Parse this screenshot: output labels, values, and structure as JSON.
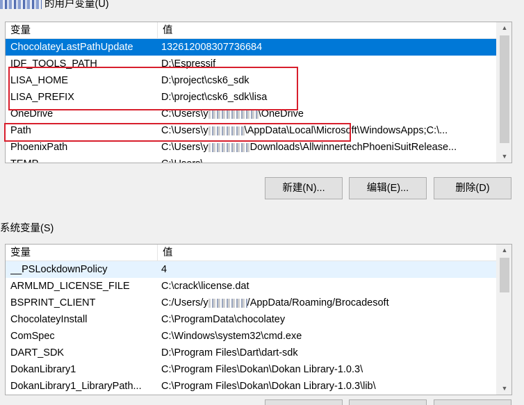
{
  "user_vars": {
    "title": "的用户变量(U)",
    "columns": {
      "name": "变量",
      "value": "值"
    },
    "rows": [
      {
        "name": "ChocolateyLastPathUpdate",
        "value": "132612008307736684",
        "selected": true
      },
      {
        "name": "IDF_TOOLS_PATH",
        "value": "D:\\Espressif"
      },
      {
        "name": "LISA_HOME",
        "value": "D:\\project\\csk6_sdk"
      },
      {
        "name": "LISA_PREFIX",
        "value": "D:\\project\\csk6_sdk\\lisa"
      },
      {
        "name": "OneDrive",
        "value_pre": "C:\\Users\\y",
        "value_post": "\\OneDrive"
      },
      {
        "name": "Path",
        "value_pre": "C:\\Users\\y",
        "value_post": "\\AppData\\Local\\Microsoft\\WindowsApps;C:\\..."
      },
      {
        "name": "PhoenixPath",
        "value_pre": "C:\\Users\\y",
        "value_post": "Downloads\\AllwinnertechPhoeniSuitRelease..."
      },
      {
        "name": "TEMP",
        "value": "C:\\Users\\..."
      }
    ],
    "buttons": {
      "new": "新建(N)...",
      "edit": "编辑(E)...",
      "delete": "删除(D)"
    }
  },
  "system_vars": {
    "title": "系统变量(S)",
    "columns": {
      "name": "变量",
      "value": "值"
    },
    "rows": [
      {
        "name": "__PSLockdownPolicy",
        "value": "4",
        "hover": true
      },
      {
        "name": "ARMLMD_LICENSE_FILE",
        "value": "C:\\crack\\license.dat"
      },
      {
        "name": "BSPRINT_CLIENT",
        "value_pre": "C:/Users/y",
        "value_post": "/AppData/Roaming/Brocadesoft"
      },
      {
        "name": "ChocolateyInstall",
        "value": "C:\\ProgramData\\chocolatey"
      },
      {
        "name": "ComSpec",
        "value": "C:\\Windows\\system32\\cmd.exe"
      },
      {
        "name": "DART_SDK",
        "value": "D:\\Program Files\\Dart\\dart-sdk"
      },
      {
        "name": "DokanLibrary1",
        "value": "C:\\Program Files\\Dokan\\Dokan Library-1.0.3\\"
      },
      {
        "name": "DokanLibrary1_LibraryPath...",
        "value": "C:\\Program Files\\Dokan\\Dokan Library-1.0.3\\lib\\"
      }
    ]
  },
  "colors": {
    "selection": "#0078d7",
    "highlight_box": "#d81e2c",
    "hover": "#e5f3ff"
  },
  "icons": {
    "scroll_up": "▲",
    "scroll_down": "▼"
  }
}
